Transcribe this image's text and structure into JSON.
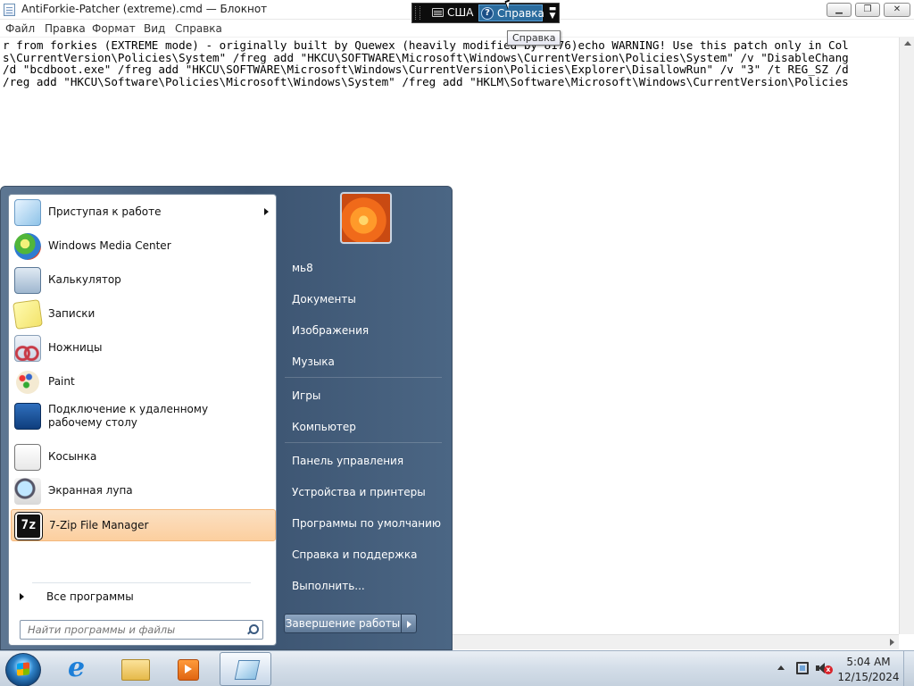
{
  "window": {
    "title": "AntiForkie-Patcher (extreme).cmd — Блокнот",
    "menu": [
      "Файл",
      "Правка",
      "Формат",
      "Вид",
      "Справка"
    ],
    "editor_lines": [
      "r from forkies (EXTREME mode) - originally built by Quewex (heavily modified by 8176)echo WARNING! Use this patch only in Col",
      "s\\CurrentVersion\\Policies\\System\" /freg add \"HKCU\\SOFTWARE\\Microsoft\\Windows\\CurrentVersion\\Policies\\System\" /v \"DisableChang",
      "/d \"bcdboot.exe\" /freg add \"HKCU\\SOFTWARE\\Microsoft\\Windows\\CurrentVersion\\Policies\\Explorer\\DisallowRun\" /v \"3\" /t REG_SZ /d",
      "/reg add \"HKCU\\Software\\Policies\\Microsoft\\Windows\\System\" /freg add \"HKLM\\Software\\Microsoft\\Windows\\CurrentVersion\\Policies"
    ]
  },
  "langbar": {
    "language": "США",
    "help_label": "Справка",
    "tooltip": "Справка"
  },
  "start_menu": {
    "programs": [
      {
        "label": "Приступая к работе",
        "icon": "getting-started-icon",
        "submenu": true
      },
      {
        "label": "Windows Media Center",
        "icon": "media-center-icon"
      },
      {
        "label": "Калькулятор",
        "icon": "calculator-icon"
      },
      {
        "label": "Записки",
        "icon": "sticky-notes-icon"
      },
      {
        "label": "Ножницы",
        "icon": "snipping-tool-icon"
      },
      {
        "label": "Paint",
        "icon": "paint-icon"
      },
      {
        "label": "Подключение к удаленному рабочему столу",
        "icon": "remote-desktop-icon"
      },
      {
        "label": "Косынка",
        "icon": "solitaire-icon"
      },
      {
        "label": "Экранная лупа",
        "icon": "magnifier-icon"
      },
      {
        "label": "7-Zip File Manager",
        "icon": "7zip-icon",
        "highlighted": true,
        "icon_text": "7z"
      }
    ],
    "all_programs": "Все программы",
    "search_placeholder": "Найти программы и файлы",
    "right_items": [
      "мь8",
      "Документы",
      "Изображения",
      "Музыка",
      "Игры",
      "Компьютер",
      "Панель управления",
      "Устройства и принтеры",
      "Программы по умолчанию",
      "Справка и поддержка",
      "Выполнить..."
    ],
    "shutdown_label": "Завершение работы"
  },
  "taskbar": {
    "clock_time": "5:04 AM",
    "clock_date": "12/15/2024",
    "mute_symbol": "x"
  }
}
